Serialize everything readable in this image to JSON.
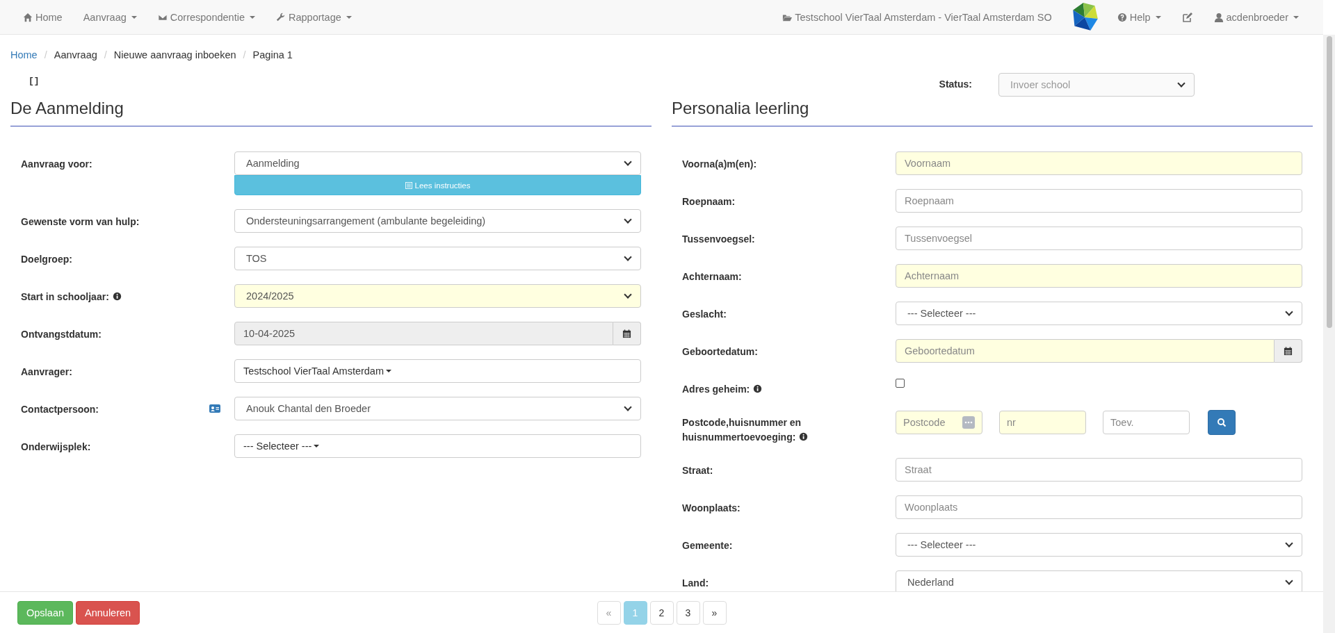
{
  "navbar": {
    "left": [
      {
        "label": "Home",
        "dropdown": false
      },
      {
        "label": "Aanvraag",
        "dropdown": true
      },
      {
        "label": "Correspondentie",
        "dropdown": true
      },
      {
        "label": "Rapportage",
        "dropdown": true
      }
    ],
    "school": "Testschool VierTaal Amsterdam - VierTaal Amsterdam SO",
    "help": {
      "label": "Help",
      "dropdown": true
    },
    "user": {
      "label": "acdenbroeder",
      "dropdown": true
    }
  },
  "breadcrumb": [
    {
      "label": "Home",
      "link": true
    },
    {
      "separator": "/",
      "label": "Aanvraag",
      "link": false
    },
    {
      "separator": "/",
      "label": "Nieuwe aanvraag inboeken",
      "link": false
    },
    {
      "separator": "/",
      "label": "Pagina 1",
      "link": false
    }
  ],
  "bracket_text": "[]",
  "status": {
    "label": "Status:",
    "value": "Invoer school",
    "disabled": true
  },
  "sections": [
    {
      "title": "De Aanmelding",
      "fields": [
        {
          "kind": "select",
          "label": "Aanvraag voor:",
          "value": "Aanmelding",
          "highlighted": false,
          "button": "Lees instructies"
        },
        {
          "kind": "select",
          "label": "Gewenste vorm van hulp:",
          "value": "Ondersteuningsarrangement (ambulante begeleiding)",
          "highlighted": false
        },
        {
          "kind": "select",
          "label": "Doelgroep:",
          "value": "TOS",
          "highlighted": false
        },
        {
          "kind": "select",
          "label": "Start in schooljaar:",
          "info": true,
          "value": "2024/2025",
          "highlighted": true
        },
        {
          "kind": "date",
          "label": "Ontvangstdatum:",
          "value": "10-04-2025",
          "disabled": true,
          "highlighted": false
        },
        {
          "kind": "picker",
          "label": "Aanvrager:",
          "value": "Testschool VierTaal Amsterdam"
        },
        {
          "kind": "select",
          "label": "Contactpersoon:",
          "contact_icon": true,
          "value": "Anouk Chantal den Broeder",
          "highlighted": false
        },
        {
          "kind": "picker",
          "label": "Onderwijsplek:",
          "value": "--- Selecteer ---"
        }
      ]
    },
    {
      "title": "Personalia leerling",
      "fields": [
        {
          "kind": "input",
          "label": "Voorna(a)m(en):",
          "placeholder": "Voornaam",
          "highlighted": true
        },
        {
          "kind": "input",
          "label": "Roepnaam:",
          "placeholder": "Roepnaam",
          "highlighted": false
        },
        {
          "kind": "input",
          "label": "Tussenvoegsel:",
          "placeholder": "Tussenvoegsel",
          "highlighted": false
        },
        {
          "kind": "input",
          "label": "Achternaam:",
          "placeholder": "Achternaam",
          "highlighted": true
        },
        {
          "kind": "select",
          "label": "Geslacht:",
          "value": "--- Selecteer ---",
          "highlighted": false
        },
        {
          "kind": "date",
          "label": "Geboortedatum:",
          "placeholder": "Geboortedatum",
          "disabled": false,
          "highlighted": true
        },
        {
          "kind": "checkbox",
          "label": "Adres geheim:",
          "info": true,
          "checked": false
        },
        {
          "kind": "address",
          "label": "Postcode,huisnummer en huisnummertoevoeging:",
          "info": true,
          "parts": [
            {
              "placeholder": "Postcode",
              "highlighted": true,
              "addon": true
            },
            {
              "placeholder": "nr",
              "highlighted": true,
              "addon": false
            },
            {
              "placeholder": "Toev.",
              "highlighted": false,
              "addon": false
            }
          ]
        },
        {
          "kind": "input",
          "label": "Straat:",
          "placeholder": "Straat",
          "highlighted": false
        },
        {
          "kind": "input",
          "label": "Woonplaats:",
          "placeholder": "Woonplaats",
          "highlighted": false
        },
        {
          "kind": "select",
          "label": "Gemeente:",
          "value": "--- Selecteer ---",
          "highlighted": false
        },
        {
          "kind": "select",
          "label": "Land:",
          "value": "Nederland",
          "highlighted": false
        }
      ]
    }
  ],
  "footer": {
    "buttons": [
      {
        "label": "Opslaan",
        "kind": "success"
      },
      {
        "label": "Annuleren",
        "kind": "danger"
      }
    ],
    "pagination": [
      {
        "label": "«",
        "selected": false,
        "disabled": true
      },
      {
        "label": "1",
        "selected": true,
        "disabled": false
      },
      {
        "label": "2",
        "selected": false,
        "disabled": false
      },
      {
        "label": "3",
        "selected": false,
        "disabled": false
      },
      {
        "label": "»",
        "selected": false,
        "disabled": false
      }
    ]
  }
}
